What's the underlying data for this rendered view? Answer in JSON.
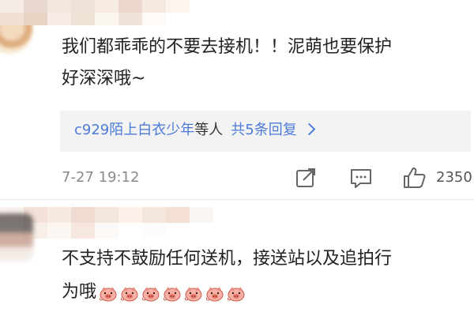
{
  "comments": [
    {
      "text_line1": "我们都乖乖的不要去接机！！泥萌也要保护",
      "text_line2": "好深深哦~",
      "replies": {
        "names": "c929陌上白衣少年",
        "suffix": "等人",
        "count": "共5条回复"
      },
      "time": "7-27 19:12",
      "likes": "2350"
    },
    {
      "text_line1": "不支持不鼓励任何送机，接送站以及追拍行",
      "text_line2": "为哦",
      "emoji_count": 7
    }
  ],
  "colors": {
    "link": "#4d7ad9",
    "reply_bg": "#f3f3f3",
    "meta": "#8a8a8a"
  },
  "icons": [
    "repost-icon",
    "comment-icon",
    "like-icon",
    "chevron-right-icon",
    "pig-emoji-icon"
  ]
}
